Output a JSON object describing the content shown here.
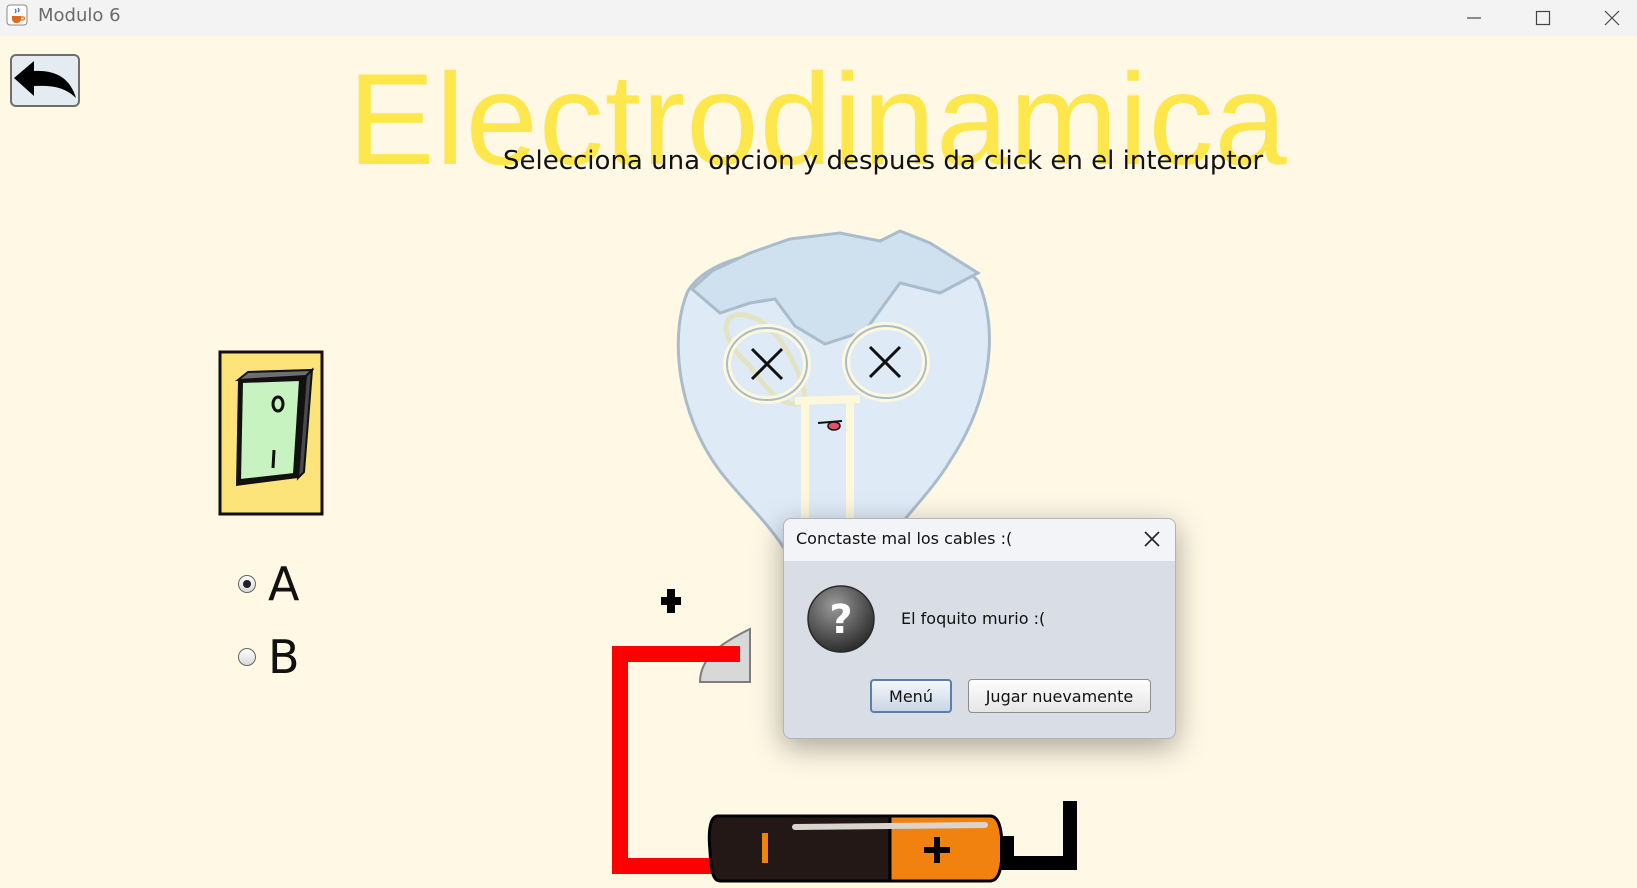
{
  "window": {
    "title": "Modulo 6",
    "icon": "java-cup-icon",
    "controls": [
      "minimize-icon",
      "maximize-icon",
      "close-icon"
    ]
  },
  "main": {
    "back_icon": "back-arrow-icon",
    "title": "Electrodinamica",
    "subtitle": "Selecciona una opcion y despues da click en el interruptor",
    "title_color": "#fde74c",
    "background_color": "#fff8e5"
  },
  "options": {
    "a_label": "A",
    "b_label": "B",
    "selected": "A"
  },
  "circuit": {
    "plus_sign": "+",
    "battery_plus": "+",
    "battery_minus": "-",
    "wire_left_color": "#ff0000",
    "wire_right_color": "#000000",
    "battery_colors": [
      "#1c1412",
      "#f08010"
    ]
  },
  "dialog": {
    "title": "Conctaste mal los cables :(",
    "message": "El foquito murio :(",
    "icon": "question-icon",
    "buttons": {
      "menu": "Menú",
      "replay": "Jugar nuevamente"
    }
  }
}
